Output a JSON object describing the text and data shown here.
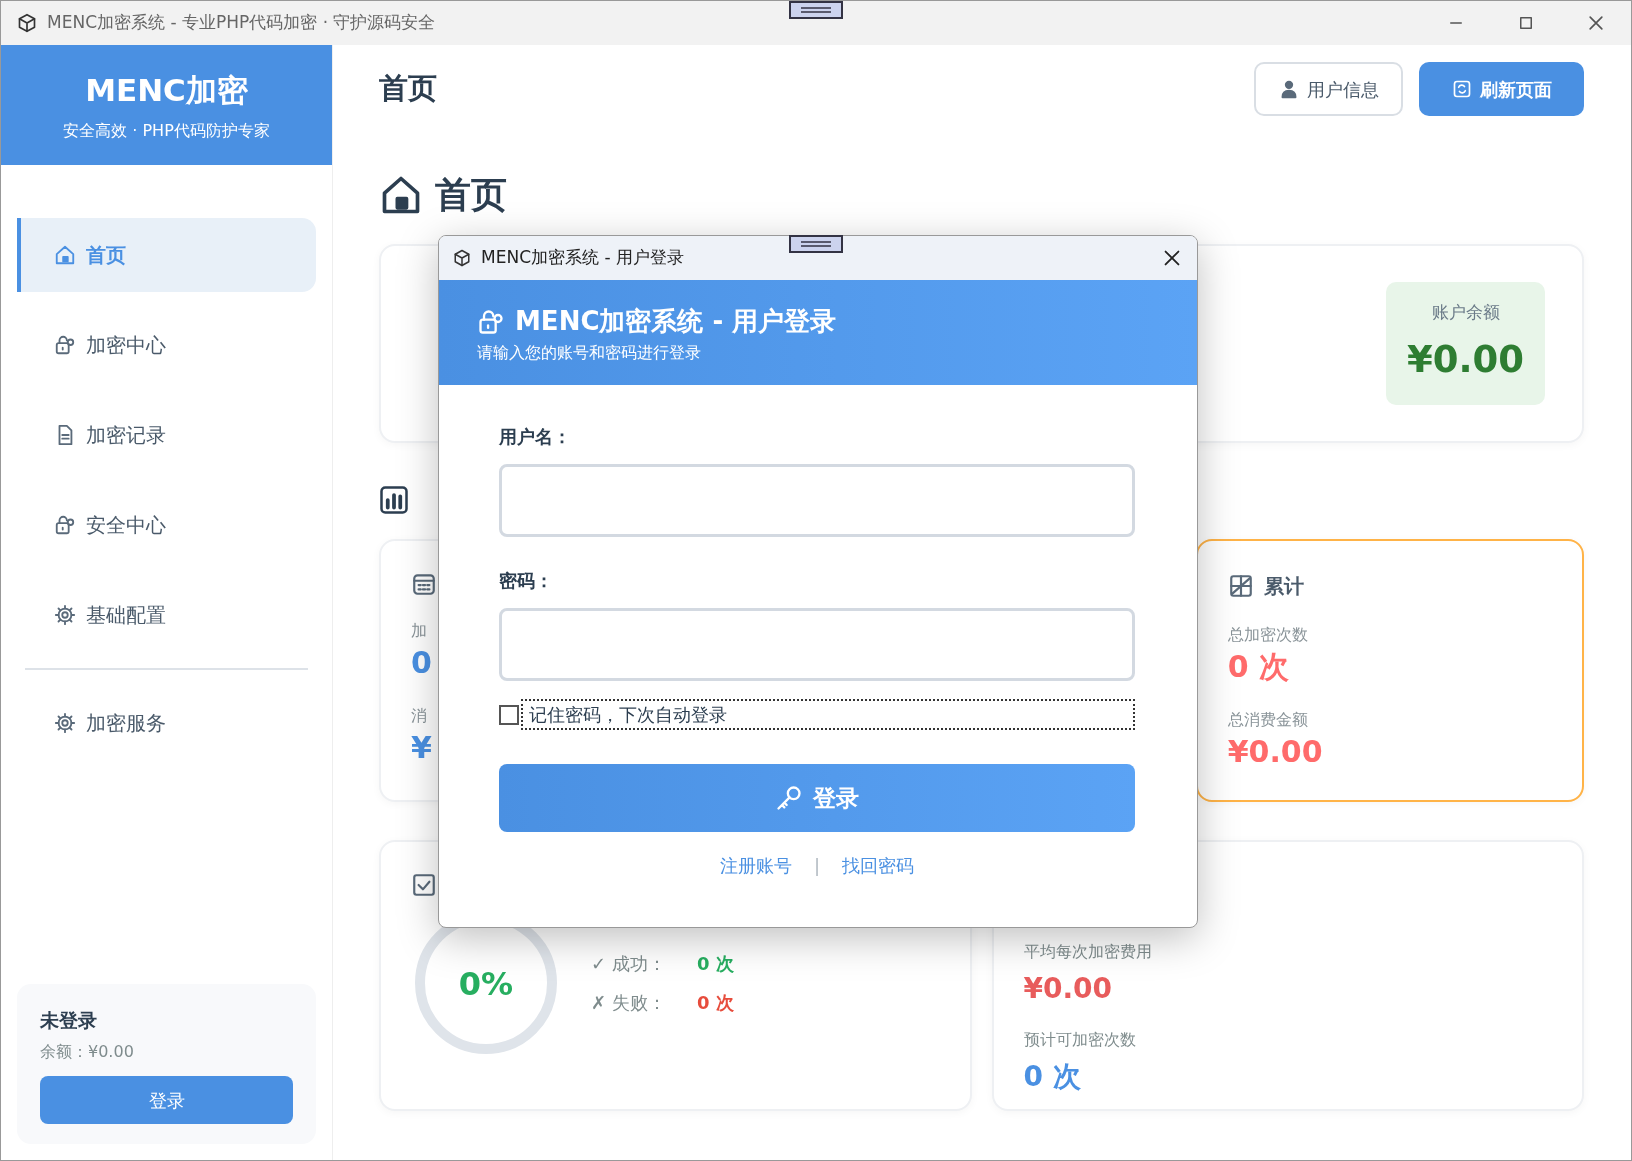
{
  "window": {
    "title": "MENC加密系统 - 专业PHP代码加密 · 守护源码安全"
  },
  "sidebar": {
    "brand": "MENC加密",
    "tagline": "安全高效 · PHP代码防护专家",
    "items": [
      {
        "label": "首页",
        "selected": true
      },
      {
        "label": "加密中心",
        "selected": false
      },
      {
        "label": "加密记录",
        "selected": false
      },
      {
        "label": "安全中心",
        "selected": false
      },
      {
        "label": "基础配置",
        "selected": false
      }
    ],
    "service_items": [
      {
        "label": "加密服务",
        "selected": false
      }
    ],
    "user": {
      "status": "未登录",
      "balance": "余额：¥0.00",
      "button": "登录"
    }
  },
  "header": {
    "title": "首页",
    "buttons": [
      {
        "label": "用户信息",
        "kind": "outline"
      },
      {
        "label": "刷新页面",
        "kind": "primary"
      }
    ]
  },
  "page": {
    "heading": "首页",
    "balance_label": "账户余额",
    "balance": "¥0.00",
    "today": {
      "label_1": "加",
      "value_1": "0",
      "label_2": "消",
      "value_2": "¥"
    },
    "total": {
      "title": "累计",
      "label_1": "总加密次数",
      "value_1": "0 次",
      "label_2": "总消费金额",
      "value_2": "¥0.00"
    },
    "success": {
      "percent": "0%",
      "rows": [
        {
          "label": "✓ 成功：",
          "value": "0 次",
          "kind": "ok"
        },
        {
          "label": "✗ 失败：",
          "value": "0 次",
          "kind": "fail"
        }
      ]
    },
    "cost": {
      "label_1": "平均每次加密费用",
      "value_1": "¥0.00",
      "label_2": "预计可加密次数",
      "value_2": "0 次"
    }
  },
  "dialog": {
    "title": "MENC加密系统 - 用户登录",
    "heading": "MENC加密系统 - 用户登录",
    "subtitle": "请输入您的账号和密码进行登录",
    "username_label": "用户名：",
    "password_label": "密码：",
    "remember": {
      "label": "记住密码，下次自动登录",
      "checked": false,
      "focused": true
    },
    "submit": "登录",
    "links": [
      "注册账号",
      "找回密码"
    ],
    "separator": "|"
  }
}
